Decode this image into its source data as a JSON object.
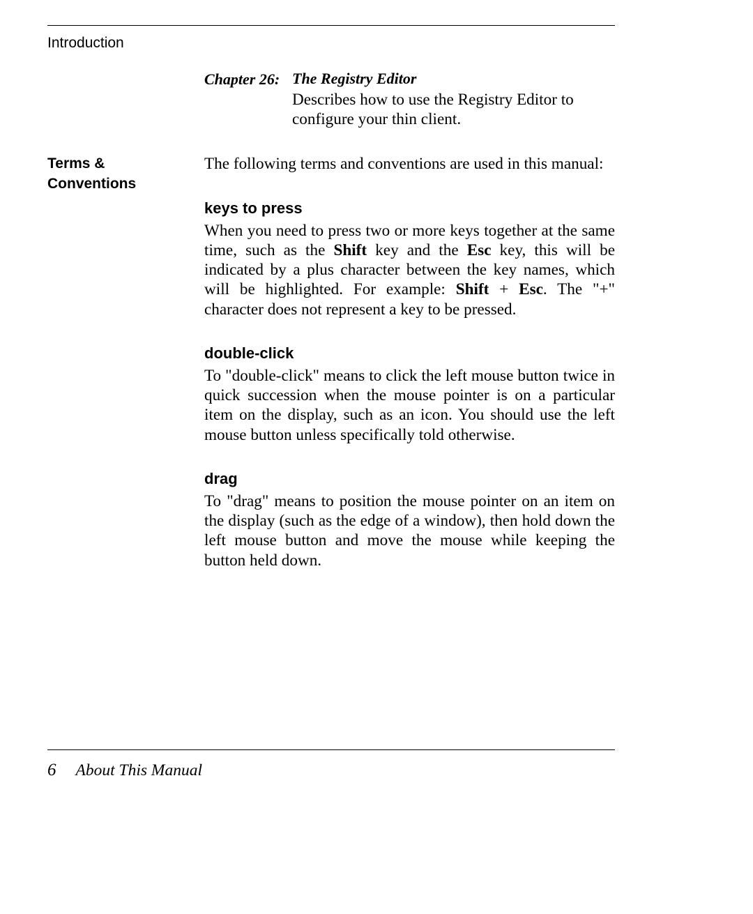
{
  "header": {
    "running_head": "Introduction"
  },
  "chapter26": {
    "label": "Chapter 26:",
    "title": "The Registry Editor",
    "desc": "Describes how to use the Registry Editor to configure your thin client."
  },
  "side": {
    "terms_label_line1": "Terms &",
    "terms_label_line2": "Conventions"
  },
  "terms": {
    "intro": "The following terms and conventions are used in this manual:",
    "keys_heading": "keys to press",
    "keys_part1": "When you need to press two or more keys together at the same time, such as the ",
    "keys_bold1": "Shift",
    "keys_part2": " key and the ",
    "keys_bold2": "Esc",
    "keys_part3": " key, this will be indicated by a plus character between the key names, which will be highlighted. For example: ",
    "keys_bold3": "Shift",
    "keys_plus": " + ",
    "keys_bold4": "Esc",
    "keys_part4": ". The \"+\" character does not represent a key to be pressed.",
    "dblclick_heading": "double-click",
    "dblclick_body": "To \"double-click\" means to click the left mouse button twice in quick succession when the mouse pointer is on a particular item on the display, such as an icon. You should use the left mouse button unless specifically told otherwise.",
    "drag_heading": "drag",
    "drag_body": "To \"drag\" means to position the mouse pointer on an item on the display (such as the edge of a window), then hold down the left mouse button and move the mouse while keeping the button held down."
  },
  "footer": {
    "page_number": "6",
    "title": "About This Manual"
  }
}
